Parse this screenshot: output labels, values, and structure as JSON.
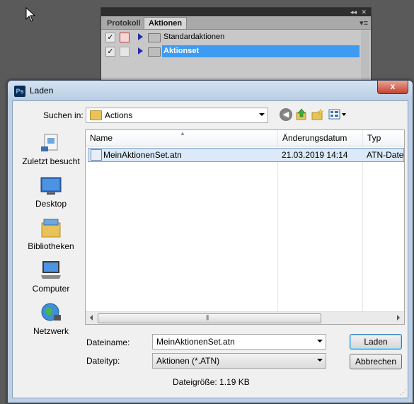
{
  "ps_panel": {
    "tabs": [
      "Protokoll",
      "Aktionen"
    ],
    "actions": [
      {
        "label": "Standardaktionen",
        "checked": true,
        "selected": false
      },
      {
        "label": "Aktionset",
        "checked": true,
        "selected": true
      }
    ]
  },
  "dialog": {
    "title": "Laden",
    "logo_text": "Ps",
    "close_glyph": "x",
    "look_in_label": "Suchen in:",
    "look_in_value": "Actions",
    "places": [
      "Zuletzt besucht",
      "Desktop",
      "Bibliotheken",
      "Computer",
      "Netzwerk"
    ],
    "columns": [
      "Name",
      "Änderungsdatum",
      "Typ"
    ],
    "files": [
      {
        "name": "MeinAktionenSet.atn",
        "date": "21.03.2019 14:14",
        "type": "ATN-Date"
      }
    ],
    "filename_label": "Dateiname:",
    "filename_value": "MeinAktionenSet.atn",
    "filetype_label": "Dateityp:",
    "filetype_value": "Aktionen (*.ATN)",
    "open_label": "Laden",
    "cancel_label": "Abbrechen",
    "filesize_text": "Dateigröße: 1.19 KB"
  },
  "colors": {
    "selection_blue": "#3d9bf3",
    "desktop_gray": "#5a5a5a",
    "dialog_frame": "#bcd0e6"
  }
}
